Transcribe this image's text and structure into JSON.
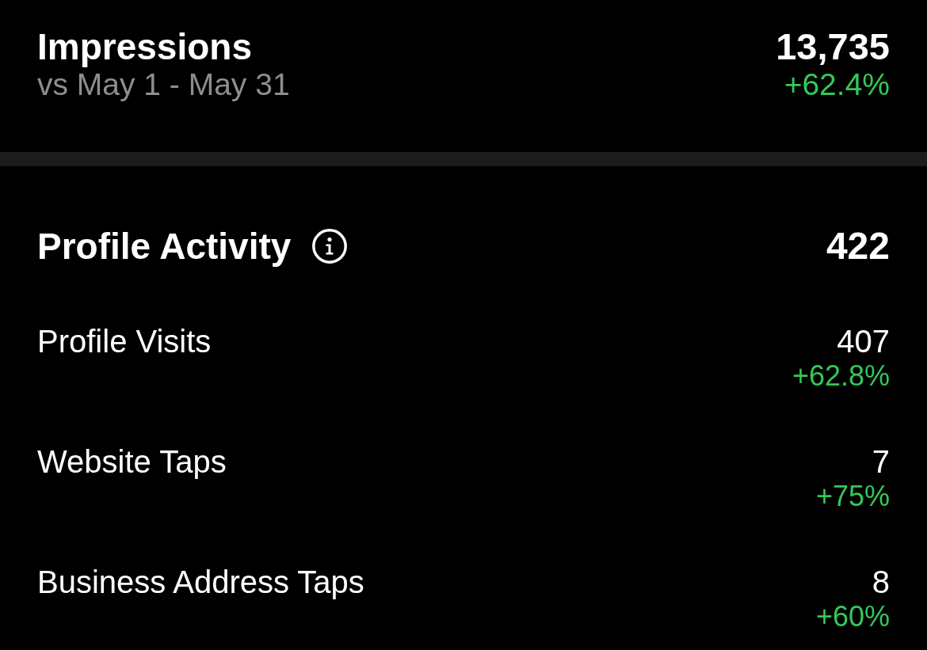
{
  "impressions": {
    "title": "Impressions",
    "comparison": "vs May 1 - May 31",
    "value": "13,735",
    "change": "+62.4%"
  },
  "profile_activity": {
    "title": "Profile Activity",
    "total": "422",
    "metrics": [
      {
        "label": "Profile Visits",
        "value": "407",
        "change": "+62.8%"
      },
      {
        "label": "Website Taps",
        "value": "7",
        "change": "+75%"
      },
      {
        "label": "Business Address Taps",
        "value": "8",
        "change": "+60%"
      }
    ]
  }
}
